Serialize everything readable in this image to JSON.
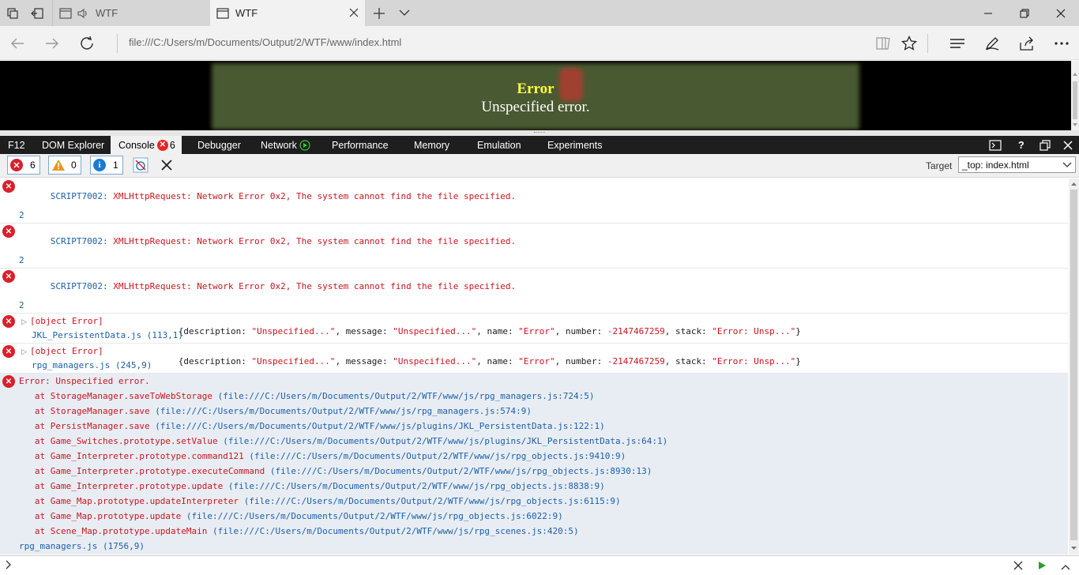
{
  "browser": {
    "tabs": [
      {
        "title": "WTF",
        "active": false,
        "icon": "page-icon",
        "audio": true
      },
      {
        "title": "WTF",
        "active": true,
        "icon": "page-icon"
      }
    ],
    "url": "file:///C:/Users/m/Documents/Output/2/WTF/www/index.html"
  },
  "page": {
    "error_title": "Error",
    "error_message": "Unspecified error."
  },
  "devtools": {
    "tabs": [
      "F12",
      "DOM Explorer",
      "Console",
      "Debugger",
      "Network",
      "Performance",
      "Memory",
      "Emulation",
      "Experiments"
    ],
    "console_error_count": "6",
    "filters": {
      "errors": "6",
      "warnings": "0",
      "info": "1"
    },
    "target_label": "Target",
    "target_value": "_top: index.html"
  },
  "console": {
    "script_errors": [
      {
        "code": "SCRIPT7002:",
        "text": " XMLHttpRequest: Network Error 0x2, The system cannot find the file specified.",
        "count": "2"
      },
      {
        "code": "SCRIPT7002:",
        "text": " XMLHttpRequest: Network Error 0x2, The system cannot find the file specified.",
        "count": "2"
      },
      {
        "code": "SCRIPT7002:",
        "text": " XMLHttpRequest: Network Error 0x2, The system cannot find the file specified.",
        "count": "2"
      }
    ],
    "object_errors": [
      {
        "label": "[object Error]",
        "detail_parts": [
          "{description: ",
          "\"Unspecified...\"",
          ", message: ",
          "\"Unspecified...\"",
          ", name: ",
          "\"Error\"",
          ", number: ",
          "-2147467259",
          ", stack: ",
          "\"Error: Unsp...\"",
          "}"
        ],
        "source": "JKL_PersistentData.js (113,1)"
      },
      {
        "label": "[object Error]",
        "detail_parts": [
          "{description: ",
          "\"Unspecified...\"",
          ", message: ",
          "\"Unspecified...\"",
          ", name: ",
          "\"Error\"",
          ", number: ",
          "-2147467259",
          ", stack: ",
          "\"Error: Unsp...\"",
          "}"
        ],
        "source": "rpg_managers.js (245,9)"
      }
    ],
    "stack_error": {
      "header": "Error: Unspecified error.",
      "frames": [
        {
          "fn": "   at StorageManager.saveToWebStorage ",
          "loc": "(file:///C:/Users/m/Documents/Output/2/WTF/www/js/rpg_managers.js:724:5)"
        },
        {
          "fn": "   at StorageManager.save ",
          "loc": "(file:///C:/Users/m/Documents/Output/2/WTF/www/js/rpg_managers.js:574:9)"
        },
        {
          "fn": "   at PersistManager.save ",
          "loc": "(file:///C:/Users/m/Documents/Output/2/WTF/www/js/plugins/JKL_PersistentData.js:122:1)"
        },
        {
          "fn": "   at Game_Switches.prototype.setValue ",
          "loc": "(file:///C:/Users/m/Documents/Output/2/WTF/www/js/plugins/JKL_PersistentData.js:64:1)"
        },
        {
          "fn": "   at Game_Interpreter.prototype.command121 ",
          "loc": "(file:///C:/Users/m/Documents/Output/2/WTF/www/js/rpg_objects.js:9410:9)"
        },
        {
          "fn": "   at Game_Interpreter.prototype.executeCommand ",
          "loc": "(file:///C:/Users/m/Documents/Output/2/WTF/www/js/rpg_objects.js:8930:13)"
        },
        {
          "fn": "   at Game_Interpreter.prototype.update ",
          "loc": "(file:///C:/Users/m/Documents/Output/2/WTF/www/js/rpg_objects.js:8838:9)"
        },
        {
          "fn": "   at Game_Map.prototype.updateInterpreter ",
          "loc": "(file:///C:/Users/m/Documents/Output/2/WTF/www/js/rpg_objects.js:6115:9)"
        },
        {
          "fn": "   at Game_Map.prototype.update ",
          "loc": "(file:///C:/Users/m/Documents/Output/2/WTF/www/js/rpg_objects.js:6022:9)"
        },
        {
          "fn": "   at Scene_Map.prototype.updateMain ",
          "loc": "(file:///C:/Users/m/Documents/Output/2/WTF/www/js/rpg_scenes.js:420:5)"
        }
      ],
      "source": "rpg_managers.js (1756,9)"
    }
  },
  "colors": {
    "error_red": "#d8212b",
    "link_blue": "#1c5fa8",
    "error_title_yellow": "#ffff40"
  }
}
